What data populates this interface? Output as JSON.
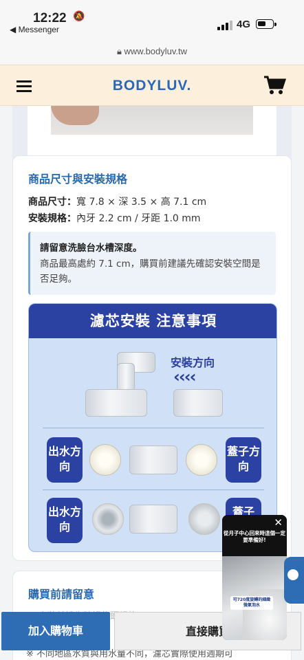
{
  "status_bar": {
    "time": "12:22",
    "back_app": "◀ Messenger",
    "network": "4G"
  },
  "browser": {
    "url": "www.bodyluv.tw"
  },
  "header": {
    "logo": "BODYLUV."
  },
  "specs": {
    "title": "商品尺寸與安裝規格",
    "size_label": "商品尺寸：",
    "size_value": "寬 7.8 × 深 3.5 × 高 7.1 cm",
    "install_label": "安裝規格：",
    "install_value": "內牙 2.2 cm / 牙距 1.0 mm",
    "notice_title": "請留意洗臉台水槽深度。",
    "notice_text": "商品最高處約 7.1 cm，購買前建議先確認安裝空間是否足夠。"
  },
  "install_image": {
    "banner": "濾芯安裝 注意事項",
    "direction_label": "安裝方向",
    "chevrons": "‹‹‹‹",
    "outlet_label": "出水方向",
    "cap_label": "蓋子方向",
    "outlet_label_2": "出水方向",
    "cap_label_2": "蓋子"
  },
  "purchase": {
    "title": "購買前請留意",
    "line1": "※ 安裝前請先確認龍頭規格…",
    "line2": "※ 不同地區水質與用水量不同，濾芯實際使用週期可"
  },
  "actions": {
    "add_to_cart": "加入購物車",
    "buy_now": "直接購買"
  },
  "video_popup": {
    "caption_top": "從月子中心回來時這個一定要準備好!",
    "caption_bottom": "可720度旋轉的細緻微氣泡水"
  }
}
